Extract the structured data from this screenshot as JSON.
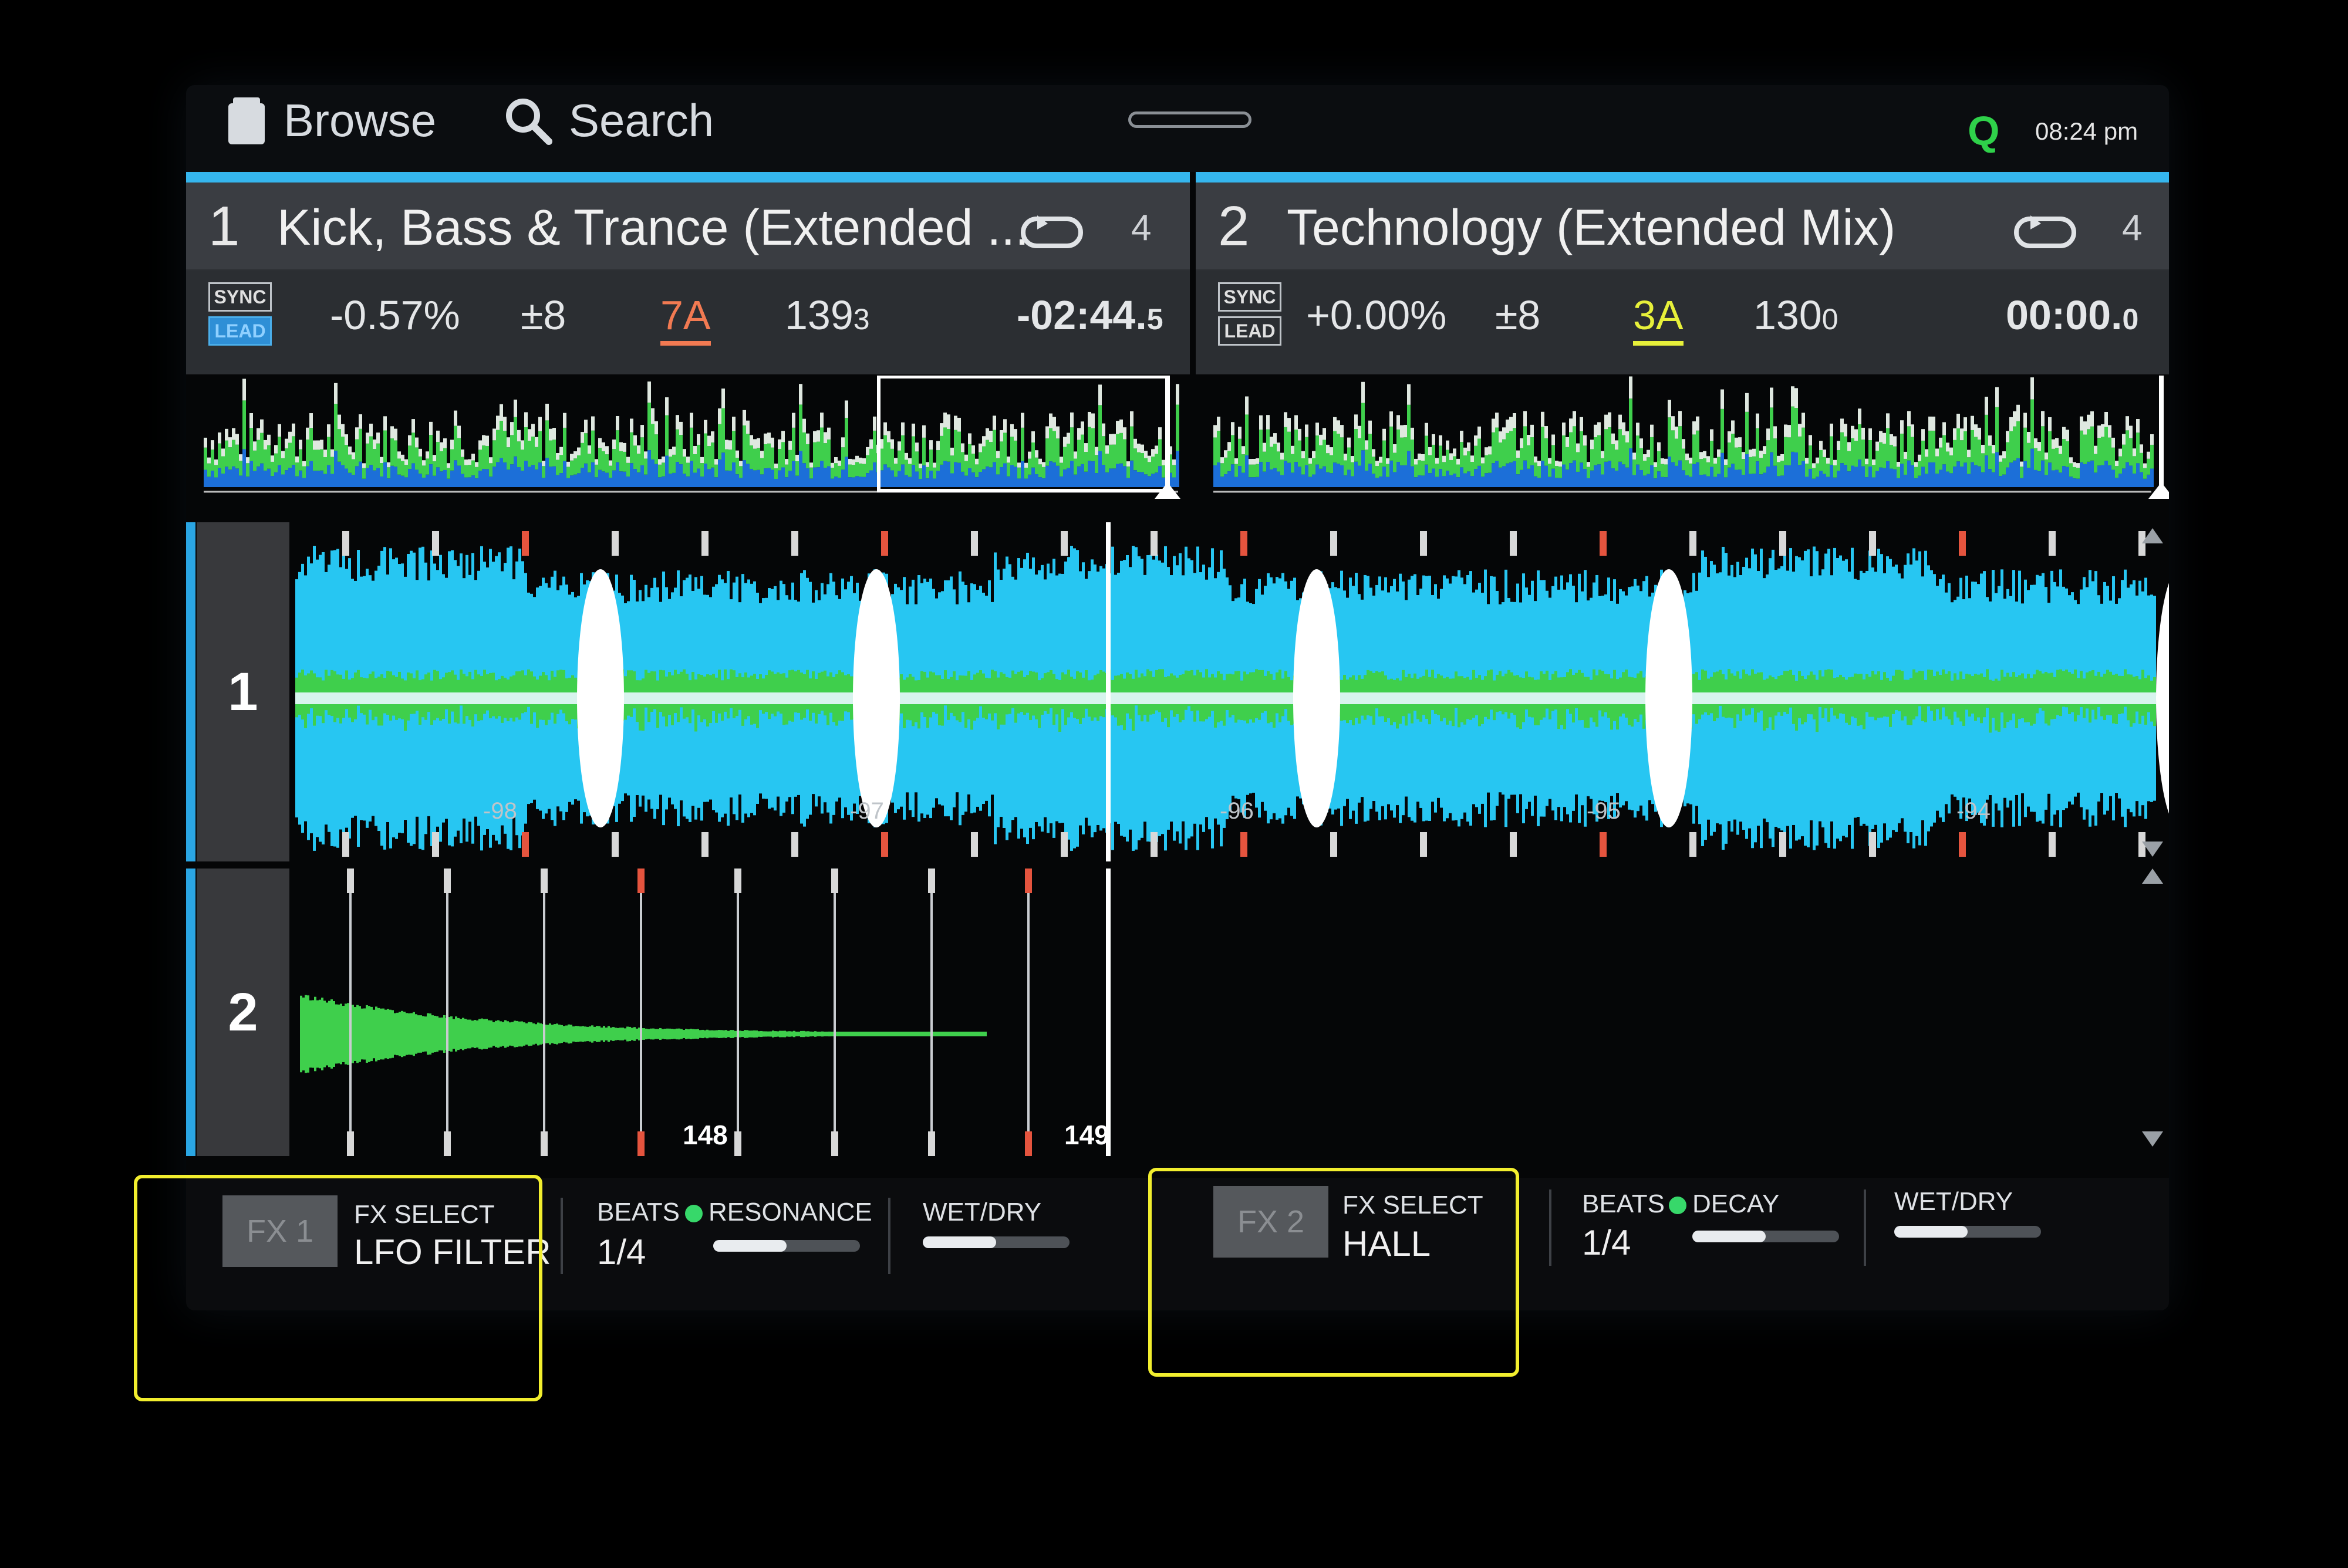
{
  "topbar": {
    "browse_label": "Browse",
    "search_label": "Search",
    "quantize_label": "Q",
    "clock": "08:24 pm"
  },
  "decks": [
    {
      "number": "1",
      "title": "Kick, Bass & Trance (Extended ...",
      "loop_beats": "4",
      "sync_label": "SYNC",
      "lead_label": "LEAD",
      "pitch": "-0.57%",
      "pitch_range": "±8",
      "key": "7A",
      "bpm_main": "139",
      "bpm_decimal": "3",
      "time_main": "-02:44.",
      "time_decimal": "5"
    },
    {
      "number": "2",
      "title": "Technology (Extended Mix)",
      "loop_beats": "4",
      "sync_label": "SYNC",
      "lead_label": "LEAD",
      "pitch": "+0.00%",
      "pitch_range": "±8",
      "key": "3A",
      "bpm_main": "130",
      "bpm_decimal": "0",
      "time_main": "00:00.",
      "time_decimal": "0"
    }
  ],
  "waveforms": {
    "lane1_label": "1",
    "lane2_label": "2",
    "lane1_beat_numbers": [
      "-98",
      "-97",
      "-96",
      "-95",
      "-94"
    ],
    "lane2_beat_numbers": [
      "148",
      "149"
    ]
  },
  "fx": [
    {
      "button_label": "FX 1",
      "select_label": "FX SELECT",
      "effect_name": "LFO FILTER",
      "beats_label": "BEATS",
      "beats_value": "1/4",
      "param_label": "RESONANCE",
      "param_level": 0.5,
      "wetdry_label": "WET/DRY",
      "wetdry_level": 0.5
    },
    {
      "button_label": "FX 2",
      "select_label": "FX SELECT",
      "effect_name": "HALL",
      "beats_label": "BEATS",
      "beats_value": "1/4",
      "param_label": "DECAY",
      "param_level": 0.5,
      "wetdry_label": "WET/DRY",
      "wetdry_level": 0.5
    }
  ],
  "colors": {
    "accent_blue": "#35b6ee",
    "wave_cyan": "#27c6f2",
    "wave_blue": "#1c6fd8",
    "wave_green": "#3fcf4c",
    "key_deck1": "#f27a52",
    "key_deck2": "#e7f03a",
    "highlight": "#f2ee2e"
  }
}
